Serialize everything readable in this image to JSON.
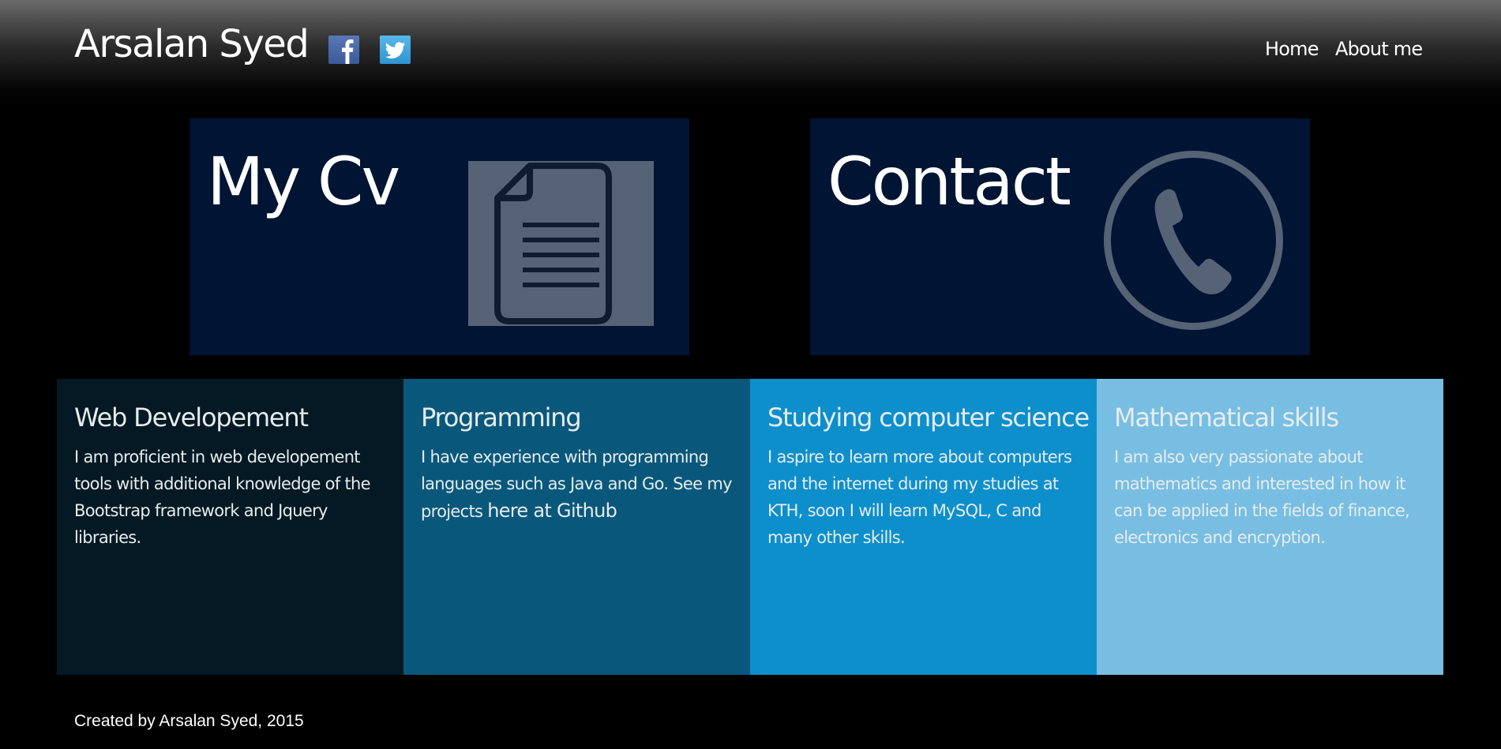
{
  "header": {
    "title": "Arsalan Syed",
    "social": [
      {
        "icon": "facebook-icon"
      },
      {
        "icon": "twitter-icon"
      }
    ],
    "nav": {
      "home": "Home",
      "about": "About me"
    }
  },
  "tiles": {
    "cv": {
      "title": "My Cv",
      "icon": "document-icon"
    },
    "contact": {
      "title": "Contact",
      "icon": "phone-icon"
    }
  },
  "panels": [
    {
      "heading": "Web Developement",
      "text": "I am proficient in web developement tools with additional knowledge of the Bootstrap framework and Jquery libraries."
    },
    {
      "heading": "Programming",
      "text": "I have experience with programming languages such as Java and Go. See my projects ",
      "link": "here at Github"
    },
    {
      "heading": "Studying computer science",
      "text": "I aspire to learn more about computers and the internet during my studies at KTH, soon I will learn MySQL, C and many other skills."
    },
    {
      "heading": "Mathematical skills",
      "text": "I am also very passionate about mathematics and interested in how it can be applied in the fields of finance, electronics and encryption."
    }
  ],
  "colors": {
    "tile_bg": "#001433",
    "panel_1": "#041923",
    "panel_2": "#09587b",
    "panel_3": "#0d8fcc",
    "panel_4": "#78bee2",
    "facebook": "#3b5a9a",
    "twitter": "#2f94d2"
  },
  "footer": {
    "text": "Created by Arsalan Syed, 2015"
  }
}
